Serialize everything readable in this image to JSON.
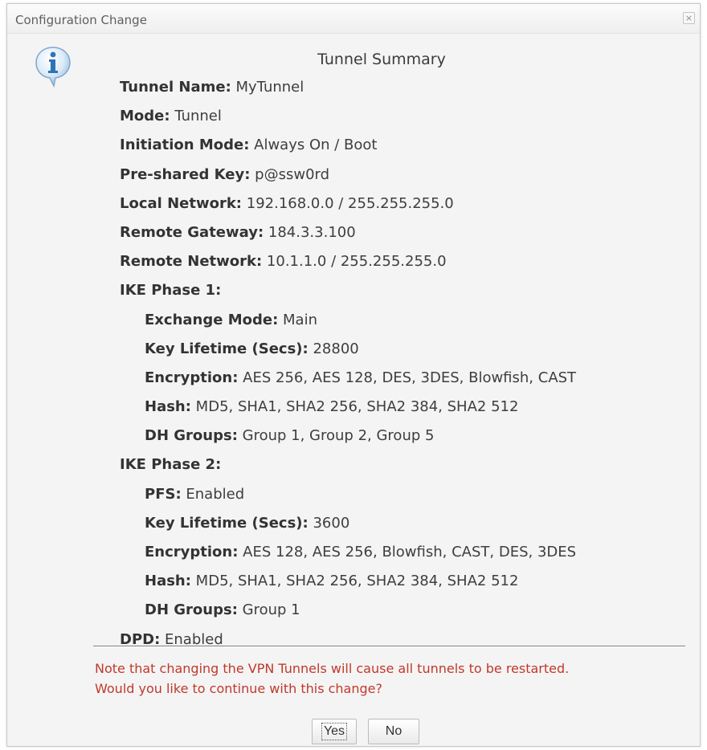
{
  "dialog": {
    "title": "Configuration Change",
    "close_label": "×",
    "icon": "info-icon",
    "heading": "Tunnel Summary"
  },
  "summary": [
    {
      "key": "Tunnel Name:",
      "value": "MyTunnel",
      "level": 0
    },
    {
      "key": "Mode:",
      "value": "Tunnel",
      "level": 0
    },
    {
      "key": "Initiation Mode:",
      "value": "Always On / Boot",
      "level": 0
    },
    {
      "key": "Pre-shared Key:",
      "value": "p@ssw0rd",
      "level": 0
    },
    {
      "key": "Local Network:",
      "value": "192.168.0.0 / 255.255.255.0",
      "level": 0
    },
    {
      "key": "Remote Gateway:",
      "value": "184.3.3.100",
      "level": 0
    },
    {
      "key": "Remote Network:",
      "value": "10.1.1.0 / 255.255.255.0",
      "level": 0
    },
    {
      "key": "IKE Phase 1:",
      "value": "",
      "level": 0
    },
    {
      "key": "Exchange Mode:",
      "value": "Main",
      "level": 1
    },
    {
      "key": "Key Lifetime (Secs):",
      "value": "28800",
      "level": 1
    },
    {
      "key": "Encryption:",
      "value": "AES 256, AES 128, DES, 3DES, Blowfish, CAST",
      "level": 1
    },
    {
      "key": "Hash:",
      "value": "MD5, SHA1, SHA2 256, SHA2 384, SHA2 512",
      "level": 1
    },
    {
      "key": "DH Groups:",
      "value": "Group 1, Group 2, Group 5",
      "level": 1
    },
    {
      "key": "IKE Phase 2:",
      "value": "",
      "level": 0
    },
    {
      "key": "PFS:",
      "value": "Enabled",
      "level": 1
    },
    {
      "key": "Key Lifetime (Secs):",
      "value": "3600",
      "level": 1
    },
    {
      "key": "Encryption:",
      "value": "AES 128, AES 256, Blowfish, CAST, DES, 3DES",
      "level": 1
    },
    {
      "key": "Hash:",
      "value": "MD5, SHA1, SHA2 256, SHA2 384, SHA2 512",
      "level": 1
    },
    {
      "key": "DH Groups:",
      "value": "Group 1",
      "level": 1
    },
    {
      "key": "DPD:",
      "value": "Enabled",
      "level": 0
    }
  ],
  "note": {
    "line1": "Note that changing the VPN Tunnels will cause all tunnels to be restarted.",
    "line2": "Would you like to continue with this change?"
  },
  "buttons": {
    "yes": "Yes",
    "no": "No"
  },
  "colors": {
    "note_text": "#c0392b",
    "icon_blue": "#3a86c8"
  }
}
